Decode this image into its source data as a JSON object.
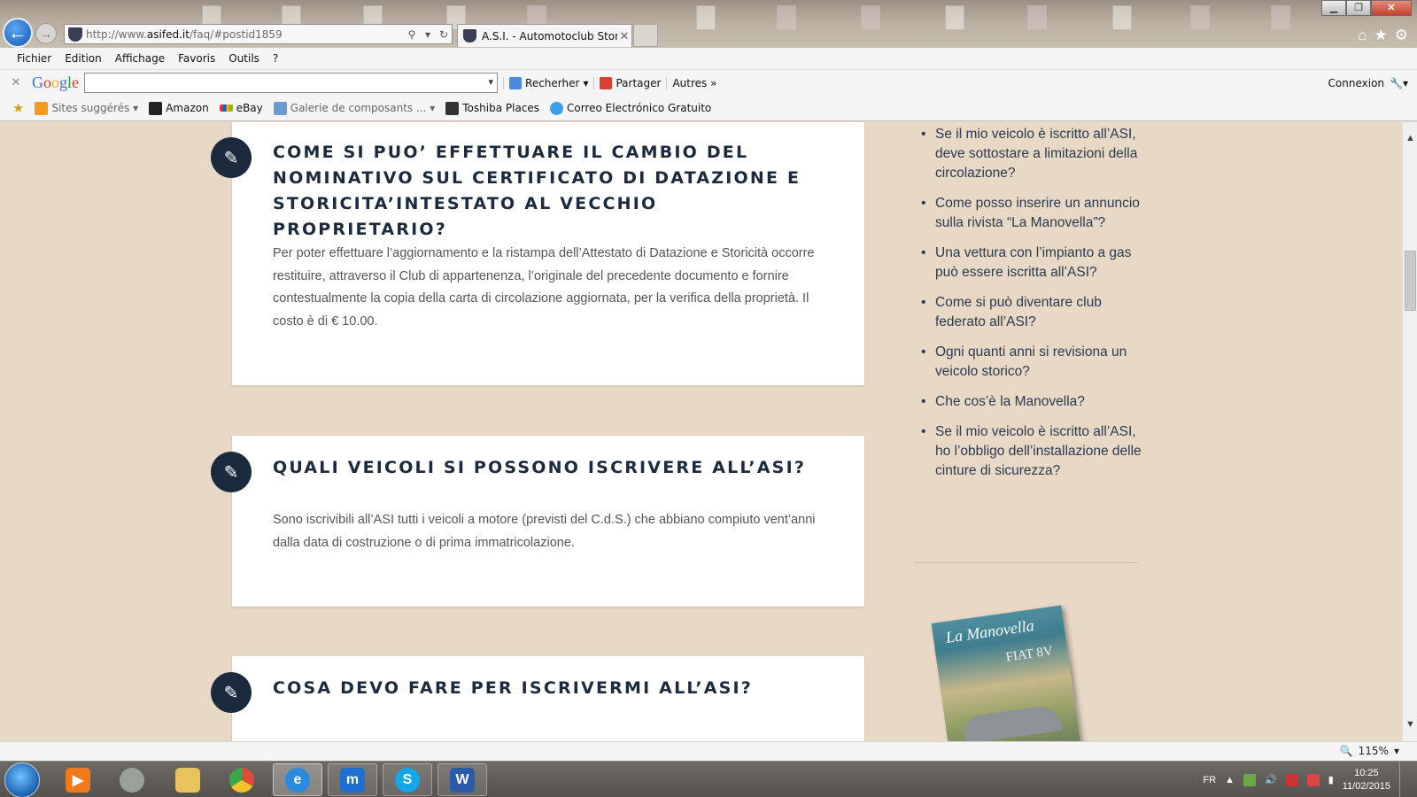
{
  "browser": {
    "address": {
      "prefix": "http://www.",
      "domain": "asifed.it",
      "path": "/faq/#postid1859"
    },
    "tab_title": "A.S.I. - Automotoclub Stori...",
    "menu": [
      "Fichier",
      "Edition",
      "Affichage",
      "Favoris",
      "Outils",
      "?"
    ],
    "google_toolbar": {
      "logo": "Google",
      "search_value": "",
      "buttons": [
        "Recherher",
        "Partager",
        "Autres »"
      ],
      "connexion": "Connexion"
    },
    "favorites": [
      {
        "label": "Sites suggérés ▾",
        "icon": "suggested-sites-icon",
        "color": "#f59a1a"
      },
      {
        "label": "Amazon",
        "icon": "amazon-icon",
        "color": "#222222"
      },
      {
        "label": "eBay",
        "icon": "ebay-icon",
        "color": "#e53238"
      },
      {
        "label": "Galerie de composants ... ▾",
        "icon": "gallery-icon",
        "color": "#6a9ad0"
      },
      {
        "label": "Toshiba Places",
        "icon": "toshiba-icon",
        "color": "#333333"
      },
      {
        "label": "Correo Electrónico Gratuito",
        "icon": "mail-icon",
        "color": "#3aa0e8"
      }
    ],
    "zoom": "115%"
  },
  "faq": [
    {
      "title": "COME SI PUO’ EFFETTUARE IL CAMBIO DEL NOMINATIVO SUL CERTIFICATO DI DATAZIONE E STORICITA’INTESTATO AL VECCHIO PROPRIETARIO?",
      "body": "Per poter effettuare l’aggiornamento e la ristampa dell’Attestato di Datazione e Storicità occorre restituire, attraverso il Club di appartenenza, l’originale del precedente documento e fornire contestualmente  la copia della carta di circolazione aggiornata, per la verifica della proprietà. Il costo è di € 10.00."
    },
    {
      "title": "QUALI VEICOLI SI POSSONO ISCRIVERE ALL’ASI?",
      "body": "Sono iscrivibili all’ASI tutti i veicoli a motore (previsti del C.d.S.) che abbiano compiuto vent’anni dalla data di costruzione o di prima immatricolazione."
    },
    {
      "title": "COSA DEVO FARE PER ISCRIVERMI ALL’ASI?",
      "body": ""
    }
  ],
  "sidebar": {
    "links": [
      "Se il mio veicolo è iscritto all’ASI, deve sottostare a limitazioni della circolazione?",
      "Come posso inserire un annuncio sulla rivista “La Manovella”?",
      "Una vettura con l’impianto a gas può essere iscritta all’ASI?",
      "Come si può diventare club federato all’ASI?",
      "Ogni quanti anni si revisiona un veicolo storico?",
      "Che cos’è la Manovella?",
      "Se il mio veicolo è iscritto all’ASI, ho l’obbligo dell’installazione delle cinture di sicurezza?"
    ],
    "magazine": {
      "title": "La Manovella",
      "subtitle": "FIAT 8V"
    }
  },
  "taskbar": {
    "apps": [
      {
        "icon": "media-player-icon",
        "color": "#f07a1a"
      },
      {
        "icon": "app-circle-icon",
        "color": "#9aa09a"
      },
      {
        "icon": "file-explorer-icon",
        "color": "#e8c25a"
      },
      {
        "icon": "chrome-icon",
        "color": "#e04a3a"
      },
      {
        "icon": "internet-explorer-icon",
        "color": "#2a8ae0"
      },
      {
        "icon": "maxthon-icon",
        "color": "#1f6fd0"
      },
      {
        "icon": "skype-icon",
        "color": "#14a7e8"
      },
      {
        "icon": "word-icon",
        "color": "#2a5aa8"
      }
    ],
    "language": "FR",
    "time": "10:25",
    "date": "11/02/2015"
  }
}
